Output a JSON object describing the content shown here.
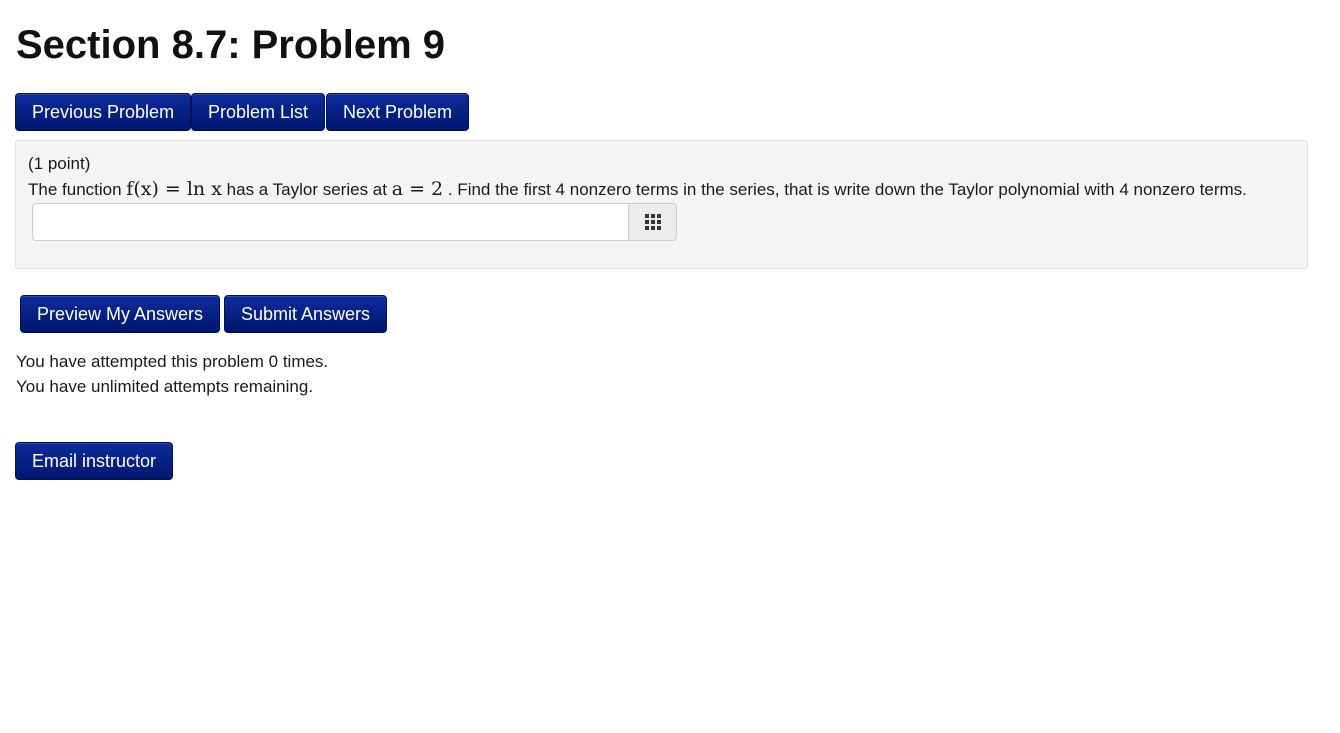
{
  "page": {
    "title": "Section 8.7: Problem 9"
  },
  "nav": {
    "previous_label": "Previous Problem",
    "list_label": "Problem List",
    "next_label": "Next Problem"
  },
  "problem": {
    "points": "(1 point)",
    "text_before_function": "The function ",
    "function_math": "f(x) = ln x",
    "text_before_point": " has a Taylor series at ",
    "point_math": "a = 2",
    "text_after": ". Find the first 4 nonzero terms in the series, that is write down the Taylor polynomial with 4 nonzero terms.",
    "answer_value": "",
    "answer_placeholder": "",
    "matrix_icon": "grid-icon"
  },
  "actions": {
    "preview_label": "Preview My Answers",
    "submit_label": "Submit Answers"
  },
  "status": {
    "attempts_text": "You have attempted this problem 0 times.",
    "remaining_text": "You have unlimited attempts remaining."
  },
  "footer": {
    "email_label": "Email instructor"
  }
}
